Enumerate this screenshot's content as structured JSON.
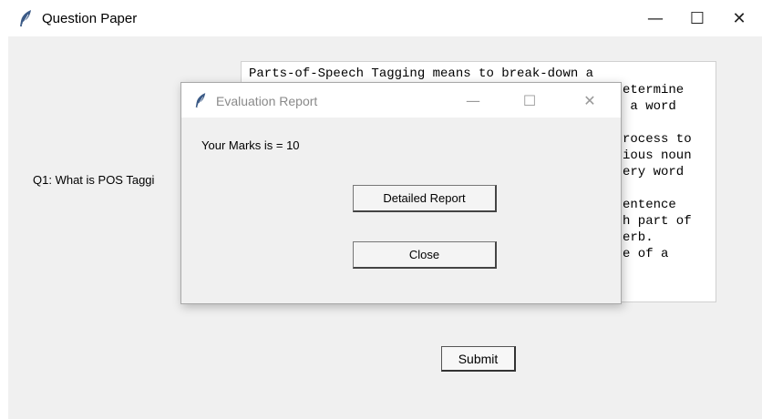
{
  "main_window": {
    "title": "Question Paper",
    "controls": {
      "minimize": "—",
      "maximize": "☐",
      "close": "✕"
    }
  },
  "question": {
    "label": "Q1: What is POS Taggi"
  },
  "answer_lines": [
    "Parts-of-Speech Tagging means to break-down a",
    "etermine",
    " a word",
    "",
    "rocess to",
    "ious noun",
    "ery word",
    "",
    "entence",
    "h part of",
    "erb.",
    "e of a"
  ],
  "submit_label": "Submit",
  "dialog": {
    "title": "Evaluation Report",
    "controls": {
      "minimize": "—",
      "maximize": "☐",
      "close": "✕"
    },
    "marks_text": "Your Marks is = 10",
    "detailed_report_label": "Detailed Report",
    "close_label": "Close"
  },
  "icons": {
    "app": "feather-icon"
  },
  "colors": {
    "window_bg": "#f0f0f0",
    "titlebar_bg": "#ffffff",
    "feather_blue": "#3b5a86"
  }
}
